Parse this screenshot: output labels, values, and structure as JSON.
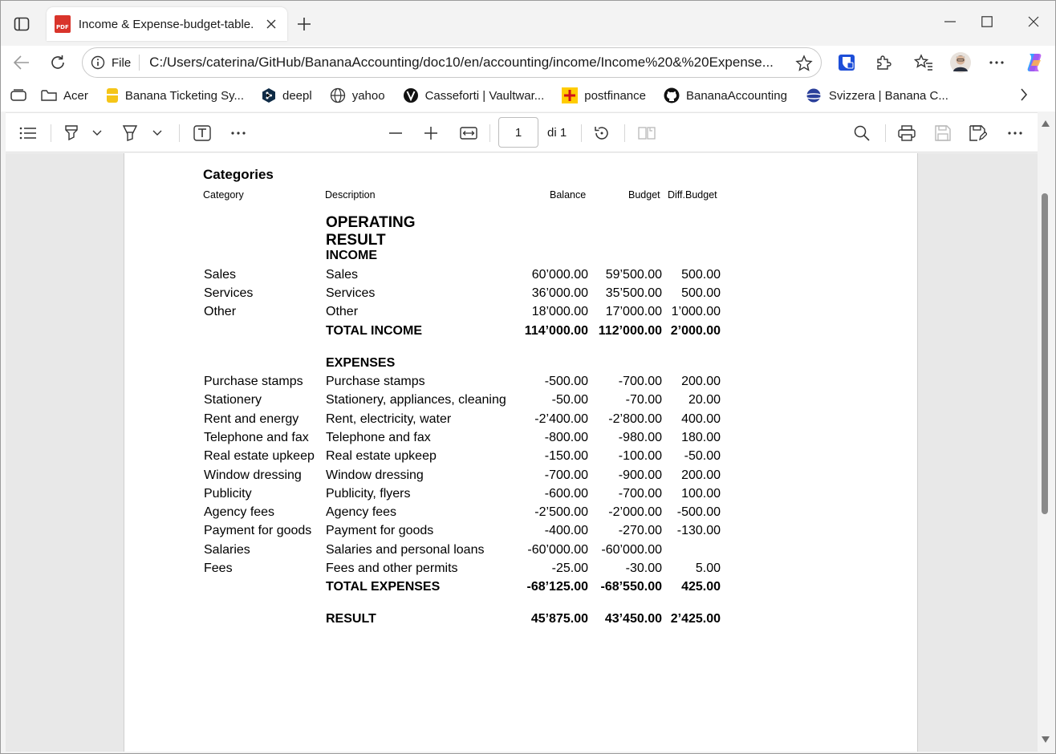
{
  "browser": {
    "tab_title": "Income & Expense-budget-table.",
    "pdf_badge": "PDF",
    "url_scheme_label": "File",
    "url": "C:/Users/caterina/GitHub/BananaAccounting/doc10/en/accounting/income/Income%20&%20Expense..."
  },
  "bookmarks": [
    {
      "label": "Acer",
      "icon": "folder-icon"
    },
    {
      "label": "Banana Ticketing Sy...",
      "icon": "banana-icon"
    },
    {
      "label": "deepl",
      "icon": "deepl-icon"
    },
    {
      "label": "yahoo",
      "icon": "globe-icon"
    },
    {
      "label": "Casseforti | Vaultwar...",
      "icon": "vaultwarden-icon"
    },
    {
      "label": "postfinance",
      "icon": "postfinance-icon"
    },
    {
      "label": "BananaAccounting",
      "icon": "github-icon"
    },
    {
      "label": "Svizzera | Banana C...",
      "icon": "planet-icon"
    }
  ],
  "pdf_toolbar": {
    "page_number": "1",
    "page_count_label": "di 1"
  },
  "document": {
    "heading": "Categories",
    "columns": {
      "category": "Category",
      "description": "Description",
      "balance": "Balance",
      "budget": "Budget",
      "diff": "Diff.Budget"
    },
    "section_title": "OPERATING RESULT",
    "income_title": "INCOME",
    "income_rows": [
      {
        "cat": "Sales",
        "desc": "Sales",
        "bal": "60’000.00",
        "bud": "59’500.00",
        "diff": "500.00"
      },
      {
        "cat": "Services",
        "desc": "Services",
        "bal": "36’000.00",
        "bud": "35’500.00",
        "diff": "500.00"
      },
      {
        "cat": "Other",
        "desc": "Other",
        "bal": "18’000.00",
        "bud": "17’000.00",
        "diff": "1’000.00"
      }
    ],
    "income_total": {
      "desc": "TOTAL INCOME",
      "bal": "114’000.00",
      "bud": "112’000.00",
      "diff": "2’000.00"
    },
    "expenses_title": "EXPENSES",
    "expense_rows": [
      {
        "cat": "Purchase stamps",
        "desc": "Purchase stamps",
        "bal": "-500.00",
        "bud": "-700.00",
        "diff": "200.00"
      },
      {
        "cat": "Stationery",
        "desc": "Stationery, appliances, cleaning",
        "bal": "-50.00",
        "bud": "-70.00",
        "diff": "20.00"
      },
      {
        "cat": "Rent and energy",
        "desc": "Rent, electricity, water",
        "bal": "-2’400.00",
        "bud": "-2’800.00",
        "diff": "400.00"
      },
      {
        "cat": "Telephone and fax",
        "desc": "Telephone and fax",
        "bal": "-800.00",
        "bud": "-980.00",
        "diff": "180.00"
      },
      {
        "cat": "Real estate upkeep",
        "desc": "Real estate upkeep",
        "bal": "-150.00",
        "bud": "-100.00",
        "diff": "-50.00"
      },
      {
        "cat": "Window dressing",
        "desc": "Window dressing",
        "bal": "-700.00",
        "bud": "-900.00",
        "diff": "200.00"
      },
      {
        "cat": "Publicity",
        "desc": "Publicity, flyers",
        "bal": "-600.00",
        "bud": "-700.00",
        "diff": "100.00"
      },
      {
        "cat": "Agency fees",
        "desc": "Agency fees",
        "bal": "-2’500.00",
        "bud": "-2’000.00",
        "diff": "-500.00"
      },
      {
        "cat": "Payment for goods",
        "desc": "Payment for goods",
        "bal": "-400.00",
        "bud": "-270.00",
        "diff": "-130.00"
      },
      {
        "cat": "Salaries",
        "desc": "Salaries and personal loans",
        "bal": "-60’000.00",
        "bud": "-60’000.00",
        "diff": ""
      },
      {
        "cat": "Fees",
        "desc": "Fees and other permits",
        "bal": "-25.00",
        "bud": "-30.00",
        "diff": "5.00"
      }
    ],
    "expenses_total": {
      "desc": "TOTAL EXPENSES",
      "bal": "-68’125.00",
      "bud": "-68’550.00",
      "diff": "425.00"
    },
    "result": {
      "desc": "RESULT",
      "bal": "45’875.00",
      "bud": "43’450.00",
      "diff": "2’425.00"
    }
  },
  "colors": {
    "pdf_red": "#d9342b",
    "banana_yellow": "#f5c518",
    "postfinance_yellow": "#ffcc00",
    "copilot_gradient": "#3aa0ff"
  }
}
